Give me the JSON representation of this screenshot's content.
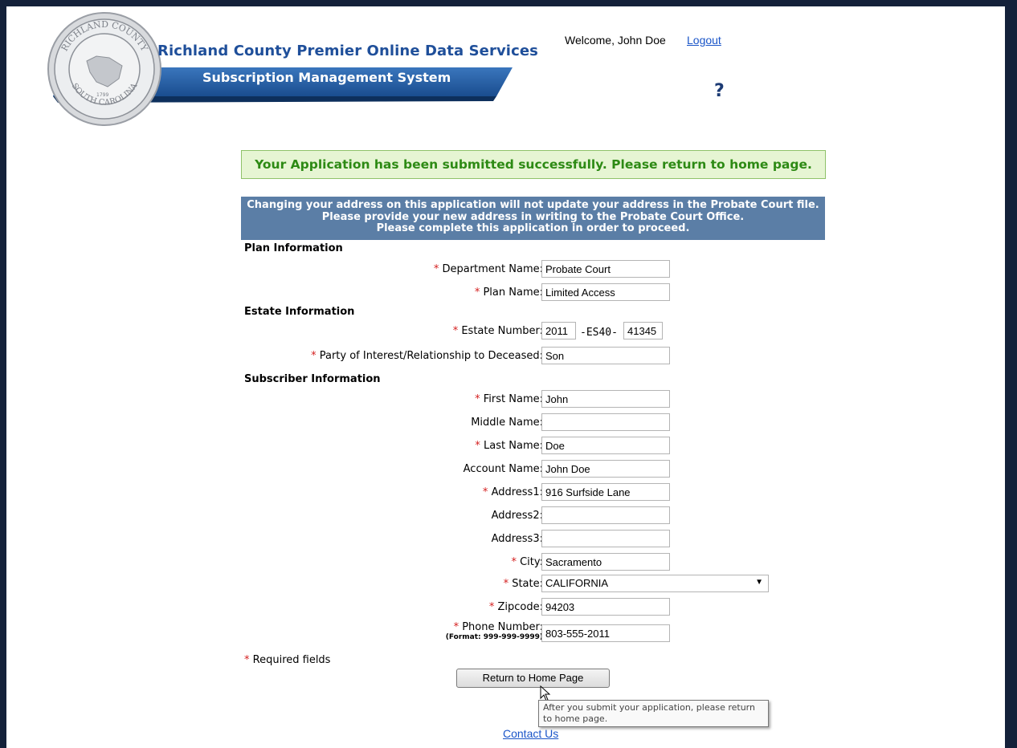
{
  "header": {
    "title_line1": "Richland County Premier Online Data Services",
    "title_line2": "Subscription Management System",
    "welcome": "Welcome, John Doe",
    "logout": "Logout",
    "help": "?",
    "seal_icon": "richland-county-seal",
    "seal_text_top": "RICHLAND COUNTY",
    "seal_text_bottom": "SOUTH CAROLINA",
    "seal_year": "1799"
  },
  "success_message": "Your Application has been submitted successfully. Please return to home page.",
  "notice": {
    "line1": "Changing your address on this application will not update your address in the Probate Court file.",
    "line2": "Please provide your new address in writing to the Probate Court Office.",
    "line3": "Please complete this application in order to proceed."
  },
  "sections": {
    "plan": "Plan Information",
    "estate": "Estate Information",
    "subscriber": "Subscriber Information"
  },
  "required_marker": "*",
  "labels": {
    "department": "Department Name:",
    "plan_name": "Plan Name:",
    "estate_number": "Estate Number:",
    "estate_mid": "-ES40-",
    "party": "Party of Interest/Relationship to Deceased:",
    "first_name": "First Name:",
    "middle_name": "Middle Name:",
    "last_name": "Last Name:",
    "account_name": "Account Name:",
    "address1": "Address1:",
    "address2": "Address2:",
    "address3": "Address3:",
    "city": "City:",
    "state": "State:",
    "zipcode": "Zipcode:",
    "phone": "Phone Number:",
    "phone_format": "(Format: 999-999-9999)"
  },
  "values": {
    "department": "Probate Court",
    "plan_name": "Limited Access",
    "estate_year": "2011",
    "estate_num": "41345",
    "party": "Son",
    "first_name": "John",
    "middle_name": "",
    "last_name": "Doe",
    "account_name": "John Doe",
    "address1": "916 Surfside Lane",
    "address2": "",
    "address3": "",
    "city": "Sacramento",
    "state": "CALIFORNIA",
    "zipcode": "94203",
    "phone": "803-555-2011"
  },
  "required_note": "Required fields",
  "return_button": "Return to Home Page",
  "tooltip": "After you submit your application, please return to home page.",
  "contact": "Contact Us",
  "colors": {
    "page_border": "#14213a",
    "title_blue": "#1f4f9a",
    "banner_blue": "#2a62a8",
    "success_bg": "#e6f5d3",
    "success_text": "#2d8a14",
    "notice_bg": "#5b7ea6",
    "required_red": "#d41e1e",
    "link_blue": "#1a55c8"
  }
}
